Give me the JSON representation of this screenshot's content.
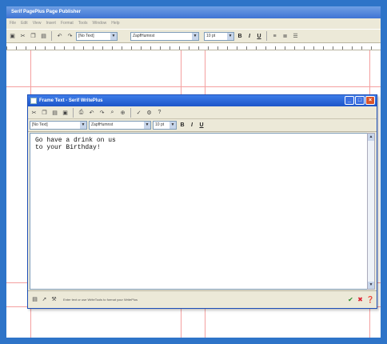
{
  "outer_window": {
    "title": "Serif PagePlus Page Publisher",
    "menu": [
      "File",
      "Edit",
      "View",
      "Insert",
      "Format",
      "Tools",
      "Window",
      "Help"
    ],
    "toolbar": {
      "style_value": "[No Text]",
      "font_value": "ZapfHumnst",
      "size_value": "10 pt",
      "format_buttons": [
        "B",
        "I",
        "U"
      ]
    }
  },
  "dialog": {
    "title": "Frame Text - Serif WritePlus",
    "toolbar": {
      "style_value": "[No Text]",
      "font_value": "ZapfHumnst",
      "size_value": "10 pt",
      "format_buttons": [
        "B",
        "I",
        "U"
      ]
    },
    "document_lines": [
      "Go have a drink on us",
      "to your Birthday!"
    ],
    "status_text": "Enter text or use WriteTools to format your WritePlus"
  },
  "icons": {
    "save": "save-icon",
    "cut": "cut-icon",
    "copy": "copy-icon",
    "paste": "paste-icon",
    "undo": "undo-icon",
    "redo": "redo-icon",
    "find": "find-icon",
    "spell": "spell-check-icon",
    "ok": "check-icon",
    "cancel": "x-icon",
    "help": "help-icon"
  },
  "colors": {
    "border": "#2e74c8",
    "titlebar": "#1c55c9",
    "margin_guide": "#f4a0a0"
  }
}
